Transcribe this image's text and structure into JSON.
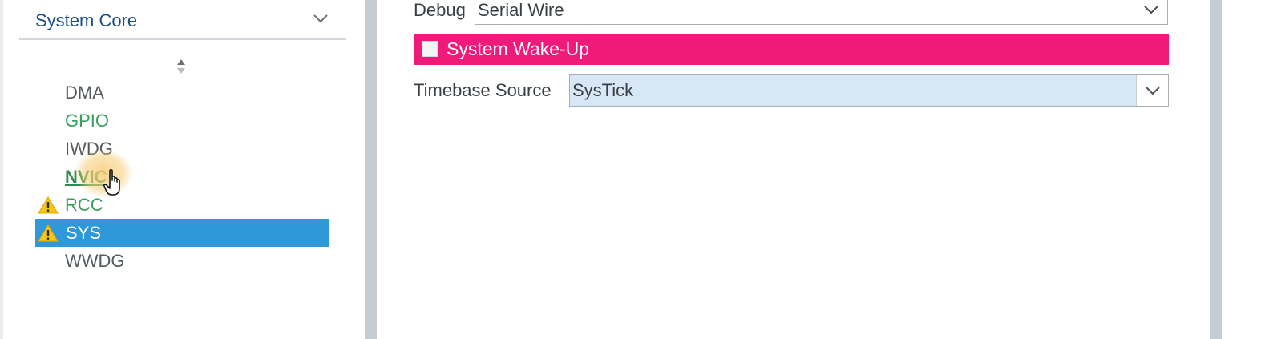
{
  "sidebar": {
    "category": "System Core",
    "items": [
      {
        "label": "DMA",
        "status": "normal",
        "warning": false
      },
      {
        "label": "GPIO",
        "status": "configured",
        "warning": false
      },
      {
        "label": "IWDG",
        "status": "normal",
        "warning": false
      },
      {
        "label": "NVIC",
        "status": "configured-hover",
        "warning": false
      },
      {
        "label": "RCC",
        "status": "configured",
        "warning": true
      },
      {
        "label": "SYS",
        "status": "selected",
        "warning": true
      },
      {
        "label": "WWDG",
        "status": "normal",
        "warning": false
      }
    ]
  },
  "config": {
    "debug": {
      "label": "Debug",
      "value": "Serial Wire"
    },
    "wakeup": {
      "label": "System Wake-Up",
      "checked": false
    },
    "timebase": {
      "label": "Timebase Source",
      "value": "SysTick"
    }
  },
  "colors": {
    "selected_bg": "#2f98d8",
    "configured_text": "#3c9f5b",
    "wakeup_bg": "#ef1a7a",
    "timebase_bg": "#d8e7f5",
    "warning": "#f5c518"
  },
  "icons": {
    "category_toggle": "chevron-down-icon",
    "sort": "sort-arrows-icon",
    "warning": "warning-triangle-icon",
    "select_arrow": "chevron-down-icon",
    "cursor": "hand-pointer-icon"
  }
}
